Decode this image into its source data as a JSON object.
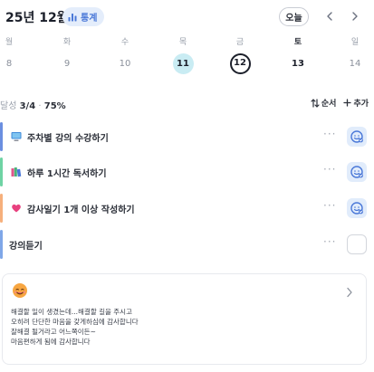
{
  "header": {
    "month": "25년 12월",
    "stats_label": "통계",
    "today_label": "오늘",
    "prev_icon": "chevron-left-icon",
    "next_icon": "chevron-right-icon"
  },
  "week": [
    {
      "dow": "월",
      "date": "8",
      "state": "normal"
    },
    {
      "dow": "화",
      "date": "9",
      "state": "normal"
    },
    {
      "dow": "수",
      "date": "10",
      "state": "normal"
    },
    {
      "dow": "목",
      "date": "11",
      "state": "done"
    },
    {
      "dow": "금",
      "date": "12",
      "state": "selected"
    },
    {
      "dow": "토",
      "date": "13",
      "state": "bold"
    },
    {
      "dow": "일",
      "date": "14",
      "state": "normal"
    }
  ],
  "progress": {
    "prefix": "달성",
    "count": "3/4",
    "separator": "·",
    "percent": "75%"
  },
  "tools": {
    "sort_label": "순서",
    "add_label": "추가"
  },
  "todos": [
    {
      "label": "주차별 강의 수강하기",
      "bar_color": "#6b8fe0",
      "icon": "monitor-icon",
      "done": true
    },
    {
      "label": "하루 1시간 독서하기",
      "bar_color": "#6fd3a4",
      "icon": "books-icon",
      "done": true
    },
    {
      "label": "감사일기 1개 이상 작성하기",
      "bar_color": "#f6b07c",
      "icon": "heart-icon",
      "done": true
    },
    {
      "label": "강의듣기",
      "bar_color": "#7fa7e8",
      "icon": "",
      "done": false
    }
  ],
  "more_label": "···",
  "diary": {
    "emoji": "smiling-face-icon",
    "lines": [
      "해결할 일이 생겼는데...해결할 길을 주시고",
      "오히려 단단한 마음을 갖게하심에 감사합니다",
      "잘해결 될거라고 어느쪽이든~",
      "마음편하게 됨에 감사합니다"
    ]
  },
  "colors": {
    "accent": "#4a78d8",
    "stats_bg": "#e4edfb",
    "done_day_bg": "#c9ecf3",
    "check_bg": "#e1ecfb"
  }
}
